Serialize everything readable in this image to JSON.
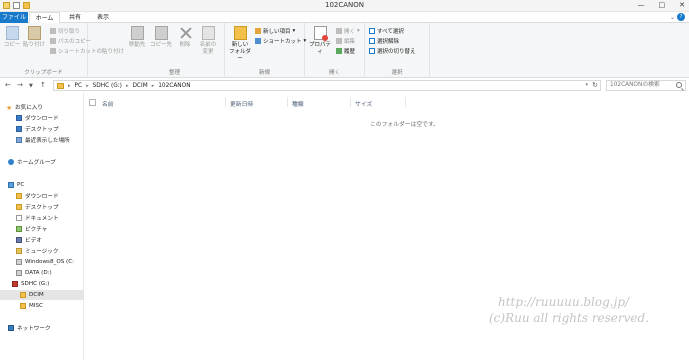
{
  "window": {
    "title": "102CANON",
    "controls": [
      "—",
      "□",
      "✕"
    ]
  },
  "ribbon_tabs": [
    {
      "label": "ファイル"
    },
    {
      "label": "ホーム"
    },
    {
      "label": "共有"
    },
    {
      "label": "表示"
    }
  ],
  "ribbon": {
    "groups": [
      {
        "label": "クリップボード"
      },
      {
        "label": "整理"
      },
      {
        "label": "新規"
      },
      {
        "label": "開く"
      },
      {
        "label": "選択"
      }
    ],
    "copy": "コピー",
    "paste": "貼り付け",
    "cut": "切り取り",
    "copy_path": "パスのコピー",
    "paste_shortcut": "ショートカットの貼り付け",
    "move_to": "移動先",
    "copy_to": "コピー先",
    "delete": "削除",
    "rename_line1": "名前の",
    "rename_line2": "変更",
    "new_folder_line1": "新しい",
    "new_folder_line2": "フォルダー",
    "new_item": "新しい項目",
    "shortcut": "ショートカット",
    "properties": "プロパティ",
    "open": "開く",
    "edit": "編集",
    "history": "履歴",
    "select_all": "すべて選択",
    "select_none": "選択解除",
    "invert_selection": "選択の切り替え"
  },
  "address": {
    "segments": [
      "PC",
      "SDHC (G:)",
      "DCIM",
      "102CANON"
    ],
    "search_placeholder": "102CANONの検索"
  },
  "nav": {
    "favorites": "お気に入り",
    "downloads": "ダウンロード",
    "desktop": "デスクトップ",
    "recent": "最近表示した場所",
    "homegroup": "ホームグループ",
    "pc": "PC",
    "pc_downloads": "ダウンロード",
    "pc_desktop": "デスクトップ",
    "documents": "ドキュメント",
    "pictures": "ピクチャ",
    "videos": "ビデオ",
    "music": "ミュージック",
    "windows_os": "Windows8_OS (C:",
    "data": "DATA (D:)",
    "sdhc": "SDHC (G:)",
    "dcim": "DCIM",
    "misc": "MISC",
    "network": "ネットワーク"
  },
  "columns": {
    "name": "名前",
    "date": "更新日時",
    "type": "種類",
    "size": "サイズ"
  },
  "empty_message": "このフォルダーは空です。",
  "watermark": {
    "line1": "http://ruuuuu.blog.jp/",
    "line2": "(c)Ruu all rights reserved."
  }
}
